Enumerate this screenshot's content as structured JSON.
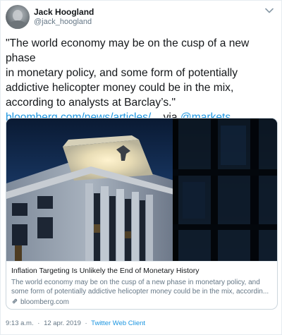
{
  "author": {
    "display_name": "Jack Hoogland",
    "handle": "@jack_hoogland"
  },
  "tweet": {
    "text_lines": [
      "\"The world economy may be on the cusp of a new phase",
      "in monetary policy, and some form of potentially",
      "addictive helicopter money could be in the mix,",
      "according to analysts at Barclay’s.\""
    ],
    "link_text": "bloomberg.com/news/articles/...",
    "via_text": "via",
    "mention": "@markets"
  },
  "card": {
    "title": "Inflation Targeting Is Unlikely the End of Monetary History",
    "description_lines": [
      "The world economy may be on the cusp of a new phase in monetary policy, and",
      "some form of potentially addictive helicopter money could be in the mix, accordin..."
    ],
    "domain": "bloomberg.com"
  },
  "footer": {
    "time": "9:13 a.m.",
    "separator": "·",
    "date": "12 apr. 2019",
    "client": "Twitter Web Client"
  },
  "colors": {
    "link": "#1b95e0",
    "secondary_text": "#657786",
    "border": "#e6ecf0"
  },
  "icons": {
    "caret": "chevron-down-icon",
    "domain": "link-icon"
  }
}
